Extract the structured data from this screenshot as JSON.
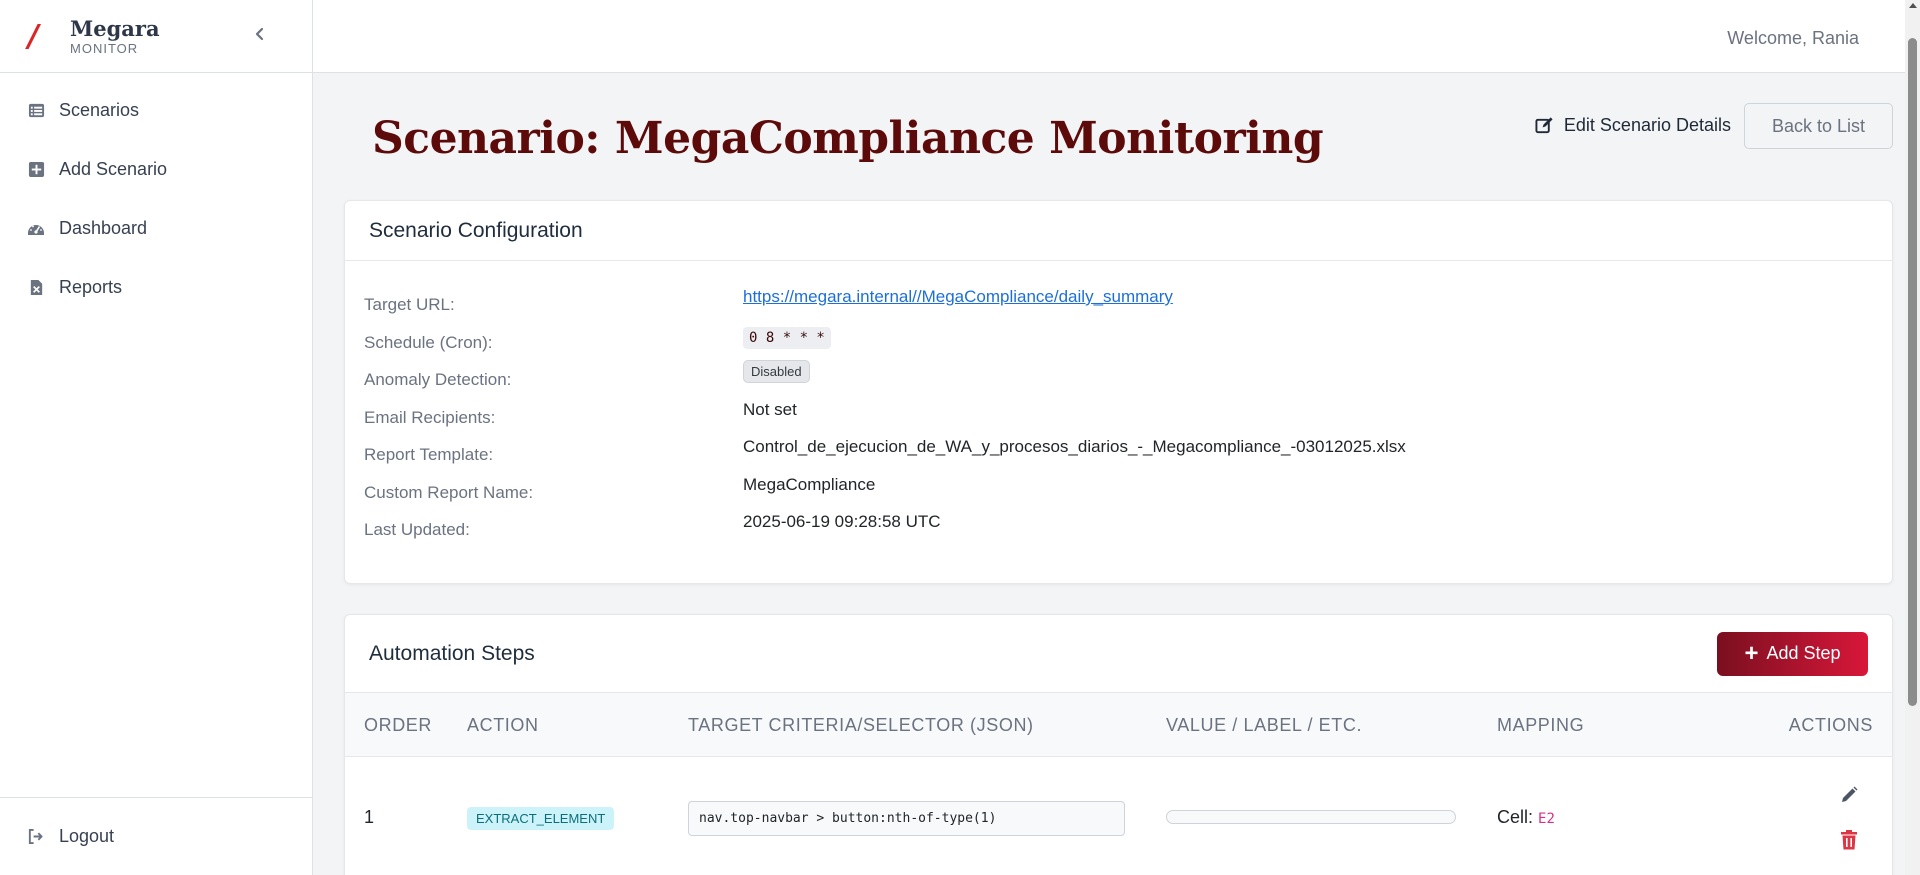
{
  "brand": {
    "name": "Megara",
    "subtitle": "MONITOR"
  },
  "sidebar": {
    "items": [
      {
        "label": "Scenarios",
        "icon": "list-icon"
      },
      {
        "label": "Add Scenario",
        "icon": "plus-square-icon"
      },
      {
        "label": "Dashboard",
        "icon": "gauge-icon"
      },
      {
        "label": "Reports",
        "icon": "file-excel-icon"
      }
    ],
    "logout_label": "Logout"
  },
  "topbar": {
    "welcome": "Welcome, Rania"
  },
  "page": {
    "title": "Scenario: MegaCompliance Monitoring",
    "edit_label": "Edit Scenario Details",
    "back_label": "Back to List"
  },
  "config": {
    "header": "Scenario Configuration",
    "rows": [
      {
        "label": "Target URL:",
        "value": "https://megara.internal//MegaCompliance/daily_summary"
      },
      {
        "label": "Schedule (Cron):",
        "value": "0 8 * * *"
      },
      {
        "label": "Anomaly Detection:",
        "value": "Disabled"
      },
      {
        "label": "Email Recipients:",
        "value": "Not set"
      },
      {
        "label": "Report Template:",
        "value": "Control_de_ejecucion_de_WA_y_procesos_diarios_-_Megacompliance_-03012025.xlsx"
      },
      {
        "label": "Custom Report Name:",
        "value": "MegaCompliance"
      },
      {
        "label": "Last Updated:",
        "value": "2025-06-19 09:28:58 UTC"
      }
    ]
  },
  "steps": {
    "header": "Automation Steps",
    "add_label": "Add Step",
    "columns": [
      "ORDER",
      "ACTION",
      "TARGET CRITERIA/SELECTOR (JSON)",
      "VALUE / LABEL / ETC.",
      "MAPPING",
      "ACTIONS"
    ],
    "rows": [
      {
        "order": "1",
        "action": "EXTRACT_ELEMENT",
        "selector": "nav.top-navbar > button:nth-of-type(1)",
        "value": "",
        "mapping_prefix": "Cell:",
        "mapping_cell": "E2"
      }
    ]
  },
  "colors": {
    "accent": "#5c0a0a",
    "button_gradient_start": "#7a0f1f",
    "button_gradient_end": "#d8173a",
    "link": "#1d6fd8",
    "danger": "#dc3545"
  }
}
